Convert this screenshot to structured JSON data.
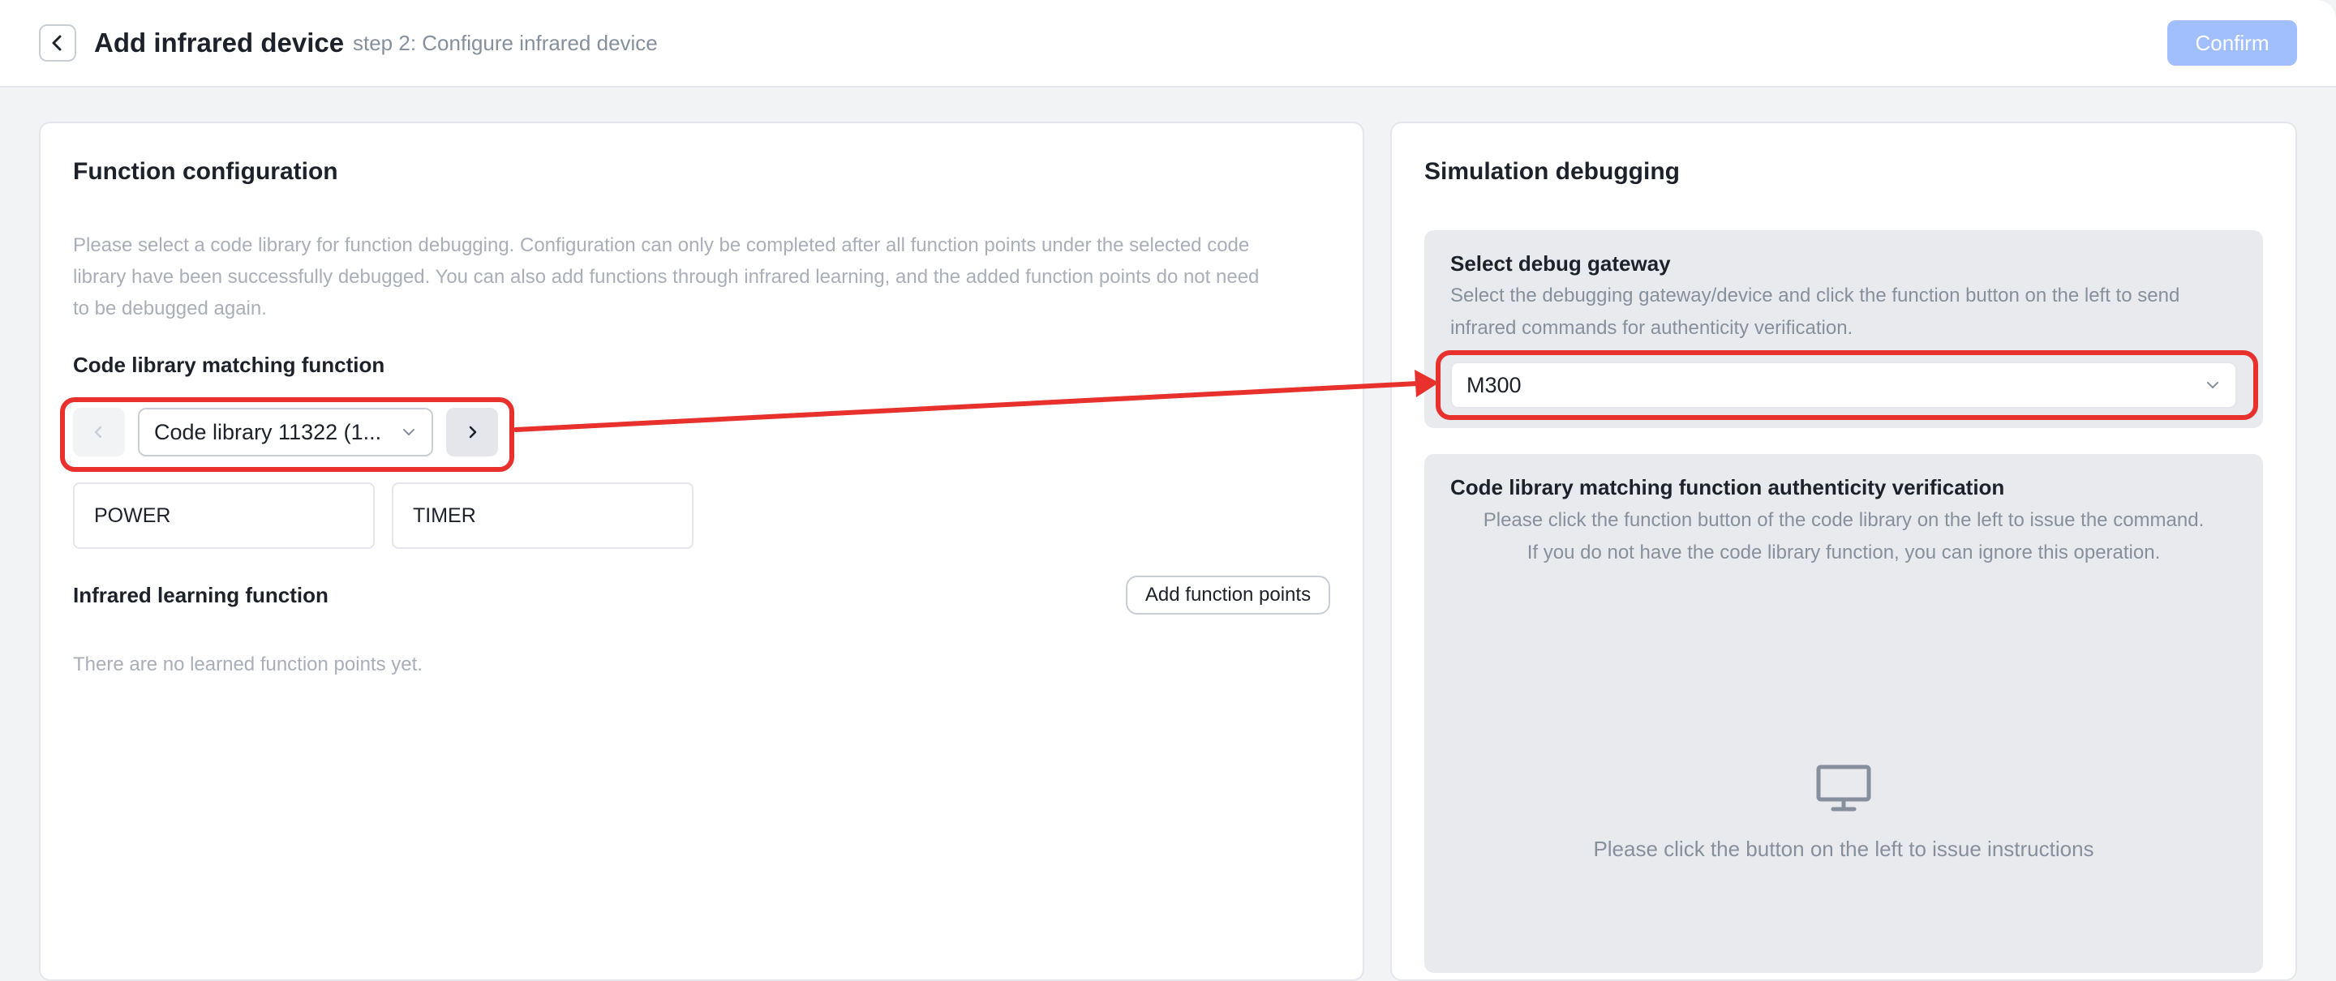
{
  "header": {
    "title": "Add infrared device",
    "subtitle": "step 2: Configure infrared device",
    "confirm_label": "Confirm"
  },
  "function_config": {
    "title": "Function configuration",
    "description_lines": [
      "Please select a code library for function debugging. Configuration can only be completed after all function points under the selected code",
      "library have been successfully debugged. You can also add functions through infrared learning, and the added function points do not need",
      "to be debugged again."
    ],
    "code_library_section": "Code library matching function",
    "code_library_selected": "Code library 11322 (1...",
    "functions": [
      "POWER",
      "TIMER"
    ],
    "infrared_section": "Infrared learning function",
    "add_function_label": "Add function points",
    "empty_text": "There are no learned function points yet."
  },
  "simulation": {
    "title": "Simulation debugging",
    "gateway_title": "Select debug gateway",
    "gateway_desc_lines": [
      "Select the debugging gateway/device and click the function button on the left to send",
      "infrared commands for authenticity verification."
    ],
    "gateway_selected": "M300",
    "verify_title": "Code library matching function authenticity verification",
    "verify_desc_lines": [
      "Please click the function button of the code library on the left to issue the command.",
      "If you do not have the code library function, you can ignore this operation."
    ],
    "placeholder_text": "Please click the button on the left to issue instructions"
  },
  "icons": {
    "back": "chevron-left-icon",
    "prev": "chevron-left-icon",
    "next": "chevron-right-icon",
    "dropdown": "chevron-down-icon",
    "monitor": "monitor-icon"
  },
  "colors": {
    "primary_disabled": "#a0bffc",
    "annotation_red": "#e8312d",
    "panel_gray": "#e9eaee"
  }
}
